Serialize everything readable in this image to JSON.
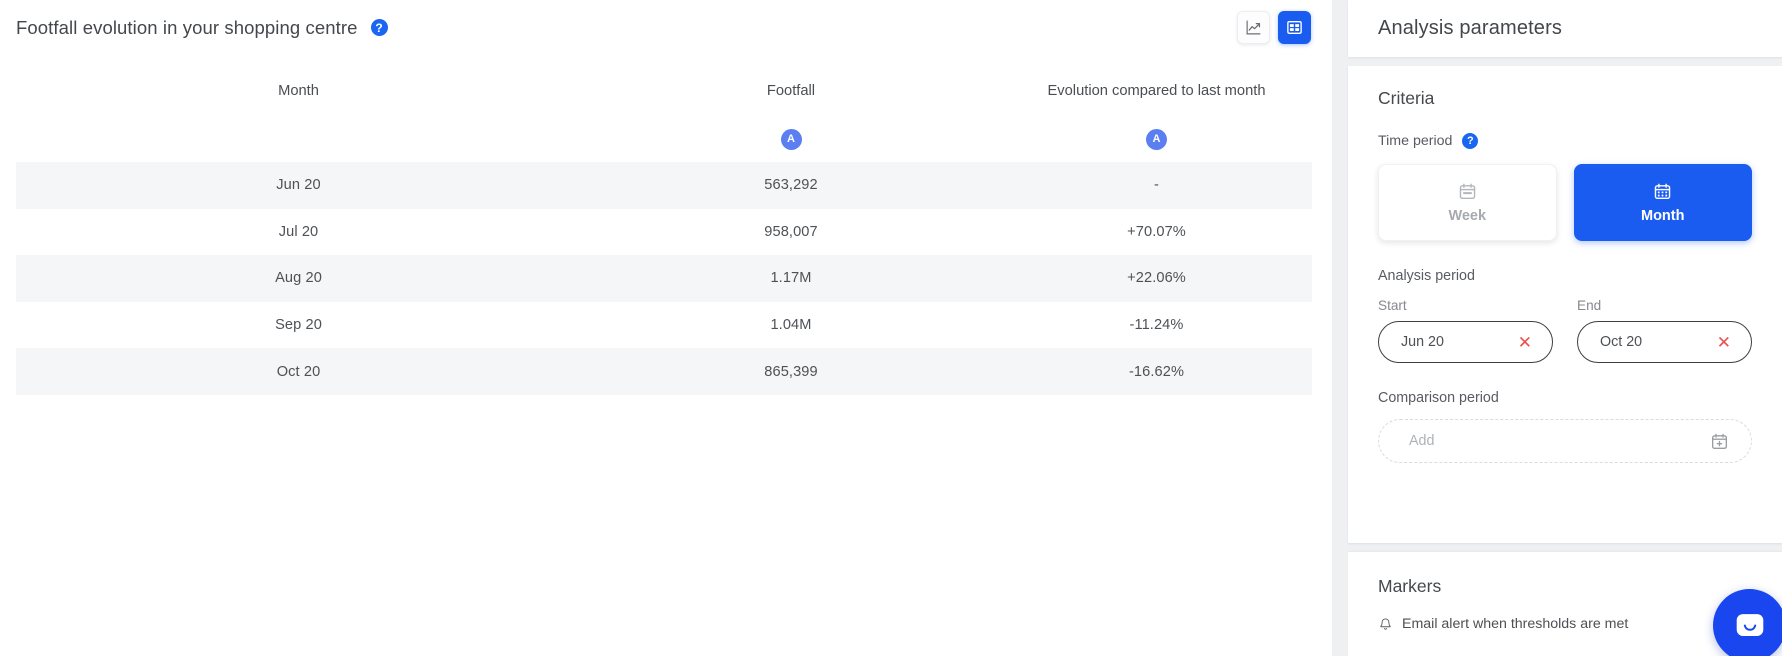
{
  "left_panel": {
    "title": "Footfall evolution in your shopping centre",
    "help_icon_label": "?",
    "view_toggle": {
      "chart_button_name": "chart-view",
      "table_button_name": "table-view",
      "active": "table"
    }
  },
  "table": {
    "columns": [
      "Month",
      "Footfall",
      "Evolution compared to last month"
    ],
    "aggregation_badges": [
      "A",
      "A"
    ],
    "rows": [
      {
        "month": "Jun 20",
        "footfall": "563,292",
        "evolution": "-"
      },
      {
        "month": "Jul 20",
        "footfall": "958,007",
        "evolution": "+70.07%"
      },
      {
        "month": "Aug 20",
        "footfall": "1.17M",
        "evolution": "+22.06%"
      },
      {
        "month": "Sep 20",
        "footfall": "1.04M",
        "evolution": "-11.24%"
      },
      {
        "month": "Oct 20",
        "footfall": "865,399",
        "evolution": "-16.62%"
      }
    ]
  },
  "chart_data": {
    "type": "table",
    "title": "Footfall evolution in your shopping centre",
    "categories": [
      "Jun 20",
      "Jul 20",
      "Aug 20",
      "Sep 20",
      "Oct 20"
    ],
    "series": [
      {
        "name": "Footfall",
        "values": [
          563292,
          958007,
          1170000,
          1040000,
          865399
        ],
        "display": [
          "563,292",
          "958,007",
          "1.17M",
          "1.04M",
          "865,399"
        ]
      },
      {
        "name": "Evolution compared to last month",
        "values": [
          null,
          70.07,
          22.06,
          -11.24,
          -16.62
        ],
        "display": [
          "-",
          "+70.07%",
          "+22.06%",
          "-11.24%",
          "-16.62%"
        ]
      }
    ],
    "xlabel": "Month",
    "ylabel": "Footfall"
  },
  "panel": {
    "header_title": "Analysis parameters",
    "criteria": {
      "section_title": "Criteria",
      "time_period_label": "Time period",
      "time_period_help": "?",
      "options": [
        {
          "label": "Week",
          "icon": "calendar-icon",
          "active": false
        },
        {
          "label": "Month",
          "icon": "calendar-icon",
          "active": true
        }
      ],
      "analysis_period_label": "Analysis period",
      "start_caption": "Start",
      "start_value": "Jun 20",
      "end_caption": "End",
      "end_value": "Oct 20",
      "clear_icon": "✕",
      "comparison_period_label": "Comparison period",
      "comparison_placeholder": "Add"
    },
    "markers": {
      "section_title": "Markers",
      "alert_label": "Email alert when thresholds are met"
    }
  },
  "chat": {
    "widget_name": "chat-launcher"
  },
  "colors": {
    "accent": "#1a5cf0",
    "badge": "#5b7ff0",
    "help": "#1a66f0",
    "clear": "#e8524f",
    "row_stripe": "#f5f6f8",
    "chat": "#1a46f0"
  }
}
